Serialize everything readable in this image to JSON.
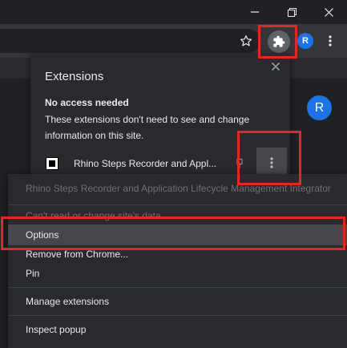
{
  "window": {
    "minimize_icon": "minimize-icon",
    "restore_icon": "restore-icon",
    "close_icon": "close-icon"
  },
  "toolbar": {
    "bookmark_icon": "star-icon",
    "extensions_icon": "puzzle-icon",
    "profile_initial": "R",
    "menu_icon": "kebab-menu-icon"
  },
  "page": {
    "profile_initial": "R"
  },
  "extensions_popup": {
    "title": "Extensions",
    "section_heading": "No access needed",
    "section_description": "These extensions don't need to see and change information on this site.",
    "extension_name": "Rhino Steps Recorder and Appl...",
    "extension_icon": "rhino-extension-icon"
  },
  "context_menu": {
    "header": "Rhino Steps Recorder and Application Lifecycle Management Integrator",
    "site_access": "Can't read or change site's data",
    "items": {
      "options": "Options",
      "remove": "Remove from Chrome...",
      "pin": "Pin",
      "manage": "Manage extensions",
      "inspect": "Inspect popup"
    }
  },
  "colors": {
    "highlight_border": "#e8261f",
    "accent": "#1a73e8"
  }
}
